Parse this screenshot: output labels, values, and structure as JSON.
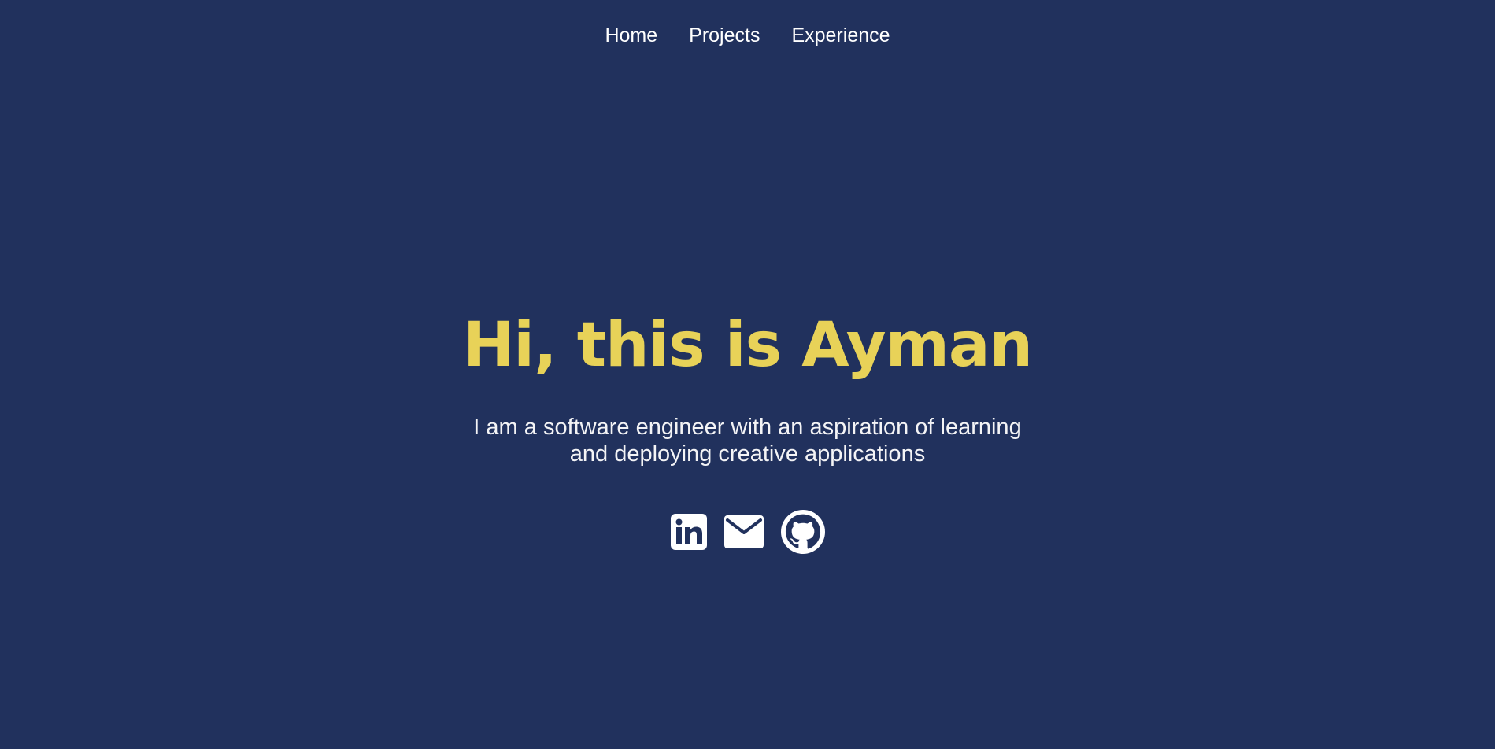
{
  "nav": {
    "items": [
      {
        "label": "Home"
      },
      {
        "label": "Projects"
      },
      {
        "label": "Experience"
      }
    ]
  },
  "hero": {
    "title": "Hi, this is Ayman",
    "subtitle": "I am a software engineer with an aspiration of learning and deploying creative applications"
  },
  "socials": [
    {
      "icon": "linkedin-icon"
    },
    {
      "icon": "mail-icon"
    },
    {
      "icon": "github-icon"
    }
  ],
  "colors": {
    "background": "#21315d",
    "accent": "#e8d258",
    "text": "#ffffff"
  }
}
